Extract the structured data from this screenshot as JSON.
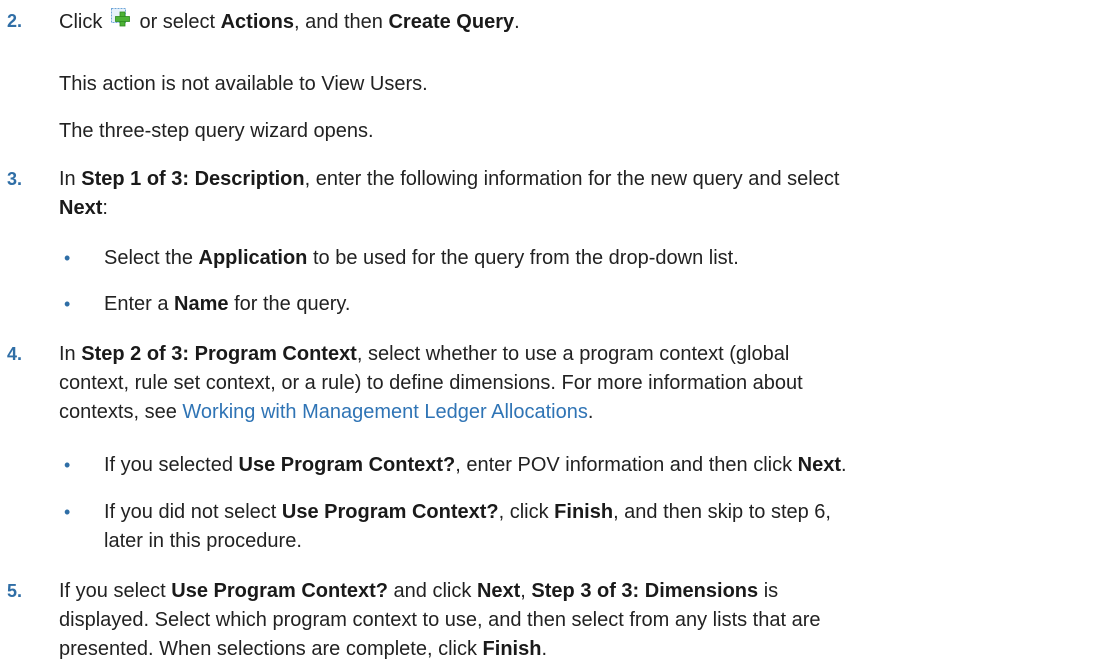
{
  "steps": {
    "s2": {
      "num": "2.",
      "p1": "Click",
      "icon": "create-query-icon",
      "p2": " or select ",
      "b1": "Actions",
      "p3": ", and then ",
      "b2": "Create Query",
      "p4": ".",
      "note1": "This action is not available to View Users.",
      "note2": "The three-step query wizard opens."
    },
    "s3": {
      "num": "3.",
      "p1": "In ",
      "b1": "Step 1 of 3: Description",
      "p2": ", enter the following information for the new query and select",
      "b2": "Next",
      "p3": ":",
      "bullets": [
        {
          "p1": "Select the ",
          "b1": "Application",
          "p2": " to be used for the query from the drop-down list."
        },
        {
          "p1": "Enter a ",
          "b1": "Name",
          "p2": " for the query."
        }
      ]
    },
    "s4": {
      "num": "4.",
      "p1": "In ",
      "b1": "Step 2 of 3: Program Context",
      "line1_rest": ", select whether to use a program context (global",
      "line2": "context, rule set context, or a rule) to define dimensions. For more information about",
      "line3_pre": "contexts, see ",
      "link": "Working with Management Ledger Allocations",
      "line3_post": ".",
      "bullets": [
        {
          "p1": "If you selected ",
          "b1": "Use Program Context?",
          "p2": ", enter POV information and then click ",
          "b2": "Next",
          "p3": "."
        },
        {
          "p1": "If you did not select ",
          "b1": "Use Program Context?",
          "p2": ", click ",
          "b2": "Finish",
          "p3": ", and then skip to step 6,",
          "line2": "later in this procedure."
        }
      ]
    },
    "s5": {
      "num": "5.",
      "p1": "If you select ",
      "b1": "Use Program Context?",
      "p2": " and click ",
      "b2": "Next",
      "p3": ", ",
      "b3": "Step 3 of 3: Dimensions",
      "p4": " is",
      "line2": "displayed. Select which program context to use, and then select from any lists that are",
      "line3_pre": "presented. When selections are complete, click ",
      "b4": "Finish",
      "line3_post": "."
    }
  },
  "colors": {
    "number": "#2f6ea6",
    "link": "#2f74b5",
    "text": "#222222"
  }
}
